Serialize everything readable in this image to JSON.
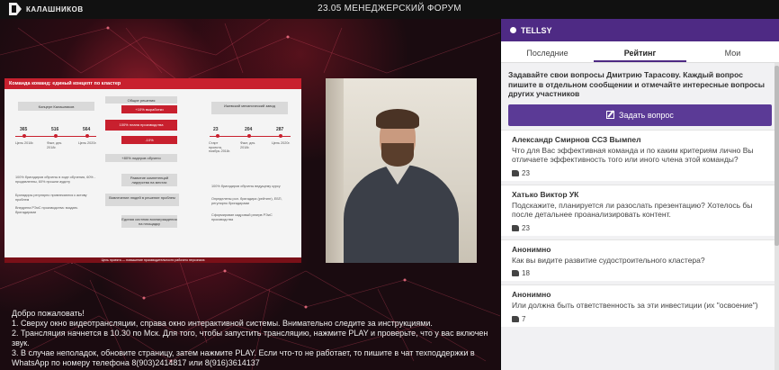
{
  "topbar": {
    "logo_text": "КАЛАШНИКОВ",
    "title": "23.05 МЕНЕДЖЕРСКИЙ ФОРУМ"
  },
  "slide": {
    "header": "Команда команд: единый концепт по кластер",
    "left_title": "Концерн Калашников",
    "center_title": "Общие решения",
    "right_title": "Ижевский механический завод",
    "left_numbers": [
      "365",
      "516",
      "564"
    ],
    "left_labels": [
      "Цель 2018г.",
      "Факт, дек. 2018г.",
      "Цель 2020г."
    ],
    "right_numbers": [
      "23",
      "204",
      "287"
    ],
    "right_labels": [
      "Старт проекта, ноябрь 2018г.",
      "Факт, дек. 2018г.",
      "Цель 2020г."
    ],
    "center_items": [
      "+10% выработки",
      "100% плана производства",
      "-10%",
      "+80% лидеров обучено",
      "Развитие компетенций лидерства на местах",
      "Вовлечение людей в решение проблем",
      "Единая система вознаграждения на площадку"
    ],
    "left_bullets": [
      "100% бригадиров обучены в ходе обучения, 60% - продавленны, 60% прошли аудиту",
      "Бригадиры регулярно привлекаются к активу проблем",
      "Внедрена РЭиС производства: воздать бригадирами"
    ],
    "right_bullets": [
      "100% бригадиров обучены ведущему курсу",
      "Определены рол. бригадира (рейтинг), ЕБП, регулярно бригадирами",
      "Сформирован кадровый резерв РЭиС производства"
    ],
    "footer": "Цель проекта — повышение производительности рабочего персонала"
  },
  "welcome": {
    "lines": [
      "Добро пожаловать!",
      "1. Сверху окно видеотрансляции, справа окно интерактивной системы. Внимательно следите за инструкциями.",
      "2. Трансляция начнется в 10.30 по Мск. Для того, чтобы запустить трансляцию, нажмите PLAY и проверьте, что у вас включен звук.",
      "3. В случае неполадок, обновите страницу, затем нажмите PLAY. Если что-то не работает, то пишите в чат техподдержки в WhatsApp по номеру телефона 8(903)2414817 или 8(916)3614137"
    ]
  },
  "panel": {
    "brand": "TELLSY",
    "tabs": [
      "Последние",
      "Рейтинг",
      "Мои"
    ],
    "active_tab": "Рейтинг",
    "intro": "Задавайте свои вопросы Дмитрию Тарасову. Каждый вопрос пишите в отдельном сообщении и отмечайте интересные вопросы других участников",
    "ask_label": "Задать вопрос",
    "questions": [
      {
        "author": "Александр Смирнов ССЗ Вымпел",
        "text": "Что для Вас эффективная команда и по каким критериям лично Вы отличаете эффективность того или иного члена этой команды?",
        "likes": "23"
      },
      {
        "author": "Хатько Виктор УК",
        "text": "Подскажите, планируется ли разослать презентацию? Хотелось бы после детальнее проанализировать контент.",
        "likes": "23"
      },
      {
        "author": "Анонимно",
        "text": "Как вы видите развитие судостроительного кластера?",
        "likes": "18"
      },
      {
        "author": "Анонимно",
        "text": "Или должна быть ответственность за эти инвестиции (их \"освоение\")",
        "likes": "7"
      }
    ],
    "accent_color": "#4e2a84"
  }
}
